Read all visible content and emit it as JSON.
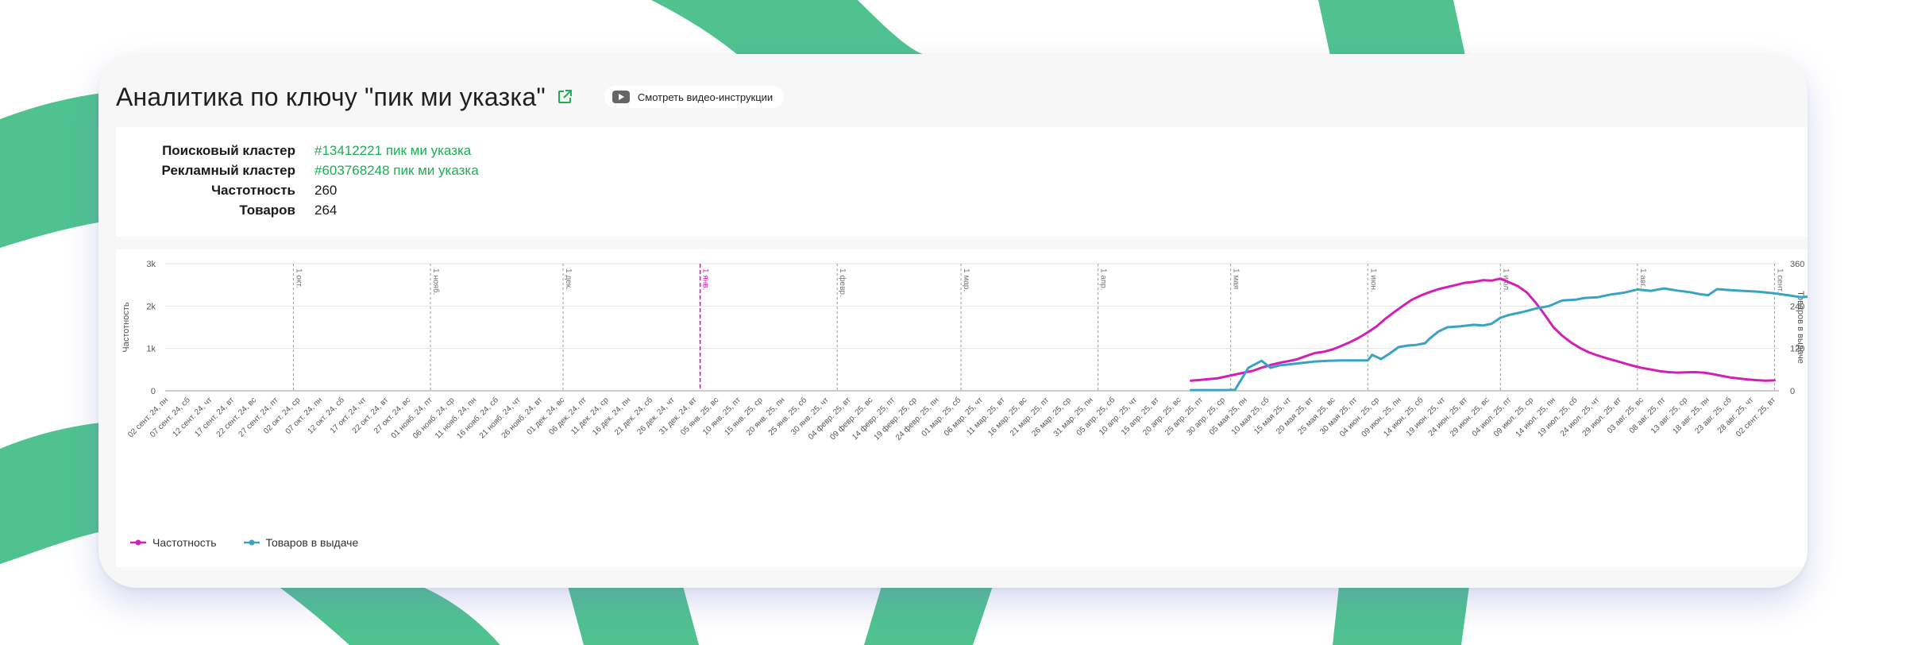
{
  "header": {
    "title": "Аналитика по ключу \"пик ми указка\"",
    "video_button_label": "Смотреть видео-инструкции"
  },
  "info": {
    "search_cluster_label": "Поисковый кластер",
    "search_cluster_value": "#13412221 пик ми указка",
    "ad_cluster_label": "Рекламный кластер",
    "ad_cluster_value": "#603768248 пик ми указка",
    "frequency_label": "Частотность",
    "frequency_value": "260",
    "products_label": "Товаров",
    "products_value": "264"
  },
  "colors": {
    "frequency": "#d21fb6",
    "products": "#3aa3c4",
    "accent_green": "#1fad55",
    "decor_green": "#4fc290"
  },
  "icons": [
    "external-link-icon",
    "video-play-icon"
  ],
  "chart_data": {
    "type": "line",
    "grid": true,
    "legend_position": "bottom-left",
    "y_left": {
      "label": "Частотность",
      "range": [
        0,
        3000
      ],
      "ticks": [
        "0",
        "1k",
        "2k",
        "3k"
      ]
    },
    "y_right": {
      "label": "Товаров в выдаче",
      "range": [
        0,
        360
      ],
      "ticks": [
        "0",
        "120",
        "240",
        "360"
      ]
    },
    "x_start": "2024-09-02",
    "x_end": "2025-09-02",
    "x_tick_labels": [
      "02 сент. 24, пн",
      "07 сент. 24, сб",
      "12 сент. 24, чт",
      "17 сент. 24, вт",
      "22 сент. 24, вс",
      "27 сент. 24, пт",
      "02 окт. 24, ср",
      "07 окт. 24, пн",
      "12 окт. 24, сб",
      "17 окт. 24, чт",
      "22 окт. 24, вт",
      "27 окт. 24, вс",
      "01 нояб. 24, пт",
      "06 нояб. 24, ср",
      "11 нояб. 24, пн",
      "16 нояб. 24, сб",
      "21 нояб. 24, чт",
      "26 нояб. 24, вт",
      "01 дек. 24, вс",
      "06 дек. 24, пт",
      "11 дек. 24, ср",
      "16 дек. 24, пн",
      "21 дек. 24, сб",
      "26 дек. 24, чт",
      "31 дек. 24, вт",
      "05 янв. 25, вс",
      "10 янв. 25, пт",
      "15 янв. 25, ср",
      "20 янв. 25, пн",
      "25 янв. 25, сб",
      "30 янв. 25, чт",
      "04 февр. 25, вт",
      "09 февр. 25, вс",
      "14 февр. 25, пт",
      "19 февр. 25, ср",
      "24 февр. 25, пн",
      "01 мар. 25, сб",
      "06 мар. 25, чт",
      "11 мар. 25, вт",
      "16 мар. 25, вс",
      "21 мар. 25, пт",
      "26 мар. 25, ср",
      "31 мар. 25, пн",
      "05 апр. 25, сб",
      "10 апр. 25, чт",
      "15 апр. 25, вт",
      "20 апр. 25, вс",
      "25 апр. 25, пт",
      "30 апр. 25, ср",
      "05 мая 25, пн",
      "10 мая 25, сб",
      "15 мая 25, чт",
      "20 мая 25, вт",
      "25 мая 25, вс",
      "30 мая 25, пт",
      "04 июн. 25, ср",
      "09 июн. 25, пн",
      "14 июн. 25, сб",
      "19 июн. 25, чт",
      "24 июн. 25, вт",
      "29 июн. 25, вс",
      "04 июл. 25, пт",
      "09 июл. 25, ср",
      "14 июл. 25, пн",
      "19 июл. 25, сб",
      "24 июл. 25, чт",
      "29 июл. 25, вт",
      "03 авг. 25, вс",
      "08 авг. 25, пт",
      "13 авг. 25, ср",
      "18 авг. 25, пн",
      "23 авг. 25, сб",
      "28 авг. 25, чт",
      "02 сент. 25, вт"
    ],
    "month_markers": [
      {
        "date": "2024-10-01",
        "label": "1 окт.",
        "highlight": false
      },
      {
        "date": "2024-11-01",
        "label": "1 нояб.",
        "highlight": false
      },
      {
        "date": "2024-12-01",
        "label": "1 дек.",
        "highlight": false
      },
      {
        "date": "2025-01-01",
        "label": "1 янв.",
        "highlight": true
      },
      {
        "date": "2025-02-01",
        "label": "1 февр.",
        "highlight": false
      },
      {
        "date": "2025-03-01",
        "label": "1 мар.",
        "highlight": false
      },
      {
        "date": "2025-04-01",
        "label": "1 апр.",
        "highlight": false
      },
      {
        "date": "2025-05-01",
        "label": "1 мая",
        "highlight": false
      },
      {
        "date": "2025-06-01",
        "label": "1 июн.",
        "highlight": false
      },
      {
        "date": "2025-07-01",
        "label": "1 июл.",
        "highlight": false
      },
      {
        "date": "2025-08-01",
        "label": "1 авг.",
        "highlight": false
      },
      {
        "date": "2025-09-01",
        "label": "1 сент.",
        "highlight": false
      }
    ],
    "series": [
      {
        "name": "Частотность",
        "axis": "left",
        "points": [
          [
            "2025-04-22",
            240
          ],
          [
            "2025-04-24",
            255
          ],
          [
            "2025-04-26",
            275
          ],
          [
            "2025-04-28",
            295
          ],
          [
            "2025-04-30",
            340
          ],
          [
            "2025-05-02",
            385
          ],
          [
            "2025-05-04",
            430
          ],
          [
            "2025-05-06",
            470
          ],
          [
            "2025-05-08",
            545
          ],
          [
            "2025-05-10",
            610
          ],
          [
            "2025-05-12",
            660
          ],
          [
            "2025-05-14",
            700
          ],
          [
            "2025-05-16",
            745
          ],
          [
            "2025-05-18",
            820
          ],
          [
            "2025-05-20",
            890
          ],
          [
            "2025-05-22",
            920
          ],
          [
            "2025-05-24",
            975
          ],
          [
            "2025-05-26",
            1060
          ],
          [
            "2025-05-28",
            1150
          ],
          [
            "2025-05-30",
            1255
          ],
          [
            "2025-06-01",
            1380
          ],
          [
            "2025-06-03",
            1520
          ],
          [
            "2025-06-05",
            1700
          ],
          [
            "2025-06-07",
            1860
          ],
          [
            "2025-06-09",
            2010
          ],
          [
            "2025-06-11",
            2150
          ],
          [
            "2025-06-13",
            2250
          ],
          [
            "2025-06-15",
            2330
          ],
          [
            "2025-06-17",
            2400
          ],
          [
            "2025-06-19",
            2450
          ],
          [
            "2025-06-21",
            2500
          ],
          [
            "2025-06-23",
            2550
          ],
          [
            "2025-06-25",
            2570
          ],
          [
            "2025-06-27",
            2610
          ],
          [
            "2025-06-29",
            2600
          ],
          [
            "2025-07-01",
            2650
          ],
          [
            "2025-07-03",
            2560
          ],
          [
            "2025-07-05",
            2470
          ],
          [
            "2025-07-07",
            2320
          ],
          [
            "2025-07-09",
            2080
          ],
          [
            "2025-07-11",
            1800
          ],
          [
            "2025-07-13",
            1500
          ],
          [
            "2025-07-15",
            1300
          ],
          [
            "2025-07-17",
            1140
          ],
          [
            "2025-07-19",
            1010
          ],
          [
            "2025-07-21",
            910
          ],
          [
            "2025-07-23",
            835
          ],
          [
            "2025-07-25",
            770
          ],
          [
            "2025-07-27",
            710
          ],
          [
            "2025-07-29",
            650
          ],
          [
            "2025-07-31",
            590
          ],
          [
            "2025-08-02",
            540
          ],
          [
            "2025-08-04",
            505
          ],
          [
            "2025-08-06",
            465
          ],
          [
            "2025-08-08",
            440
          ],
          [
            "2025-08-10",
            430
          ],
          [
            "2025-08-12",
            435
          ],
          [
            "2025-08-14",
            440
          ],
          [
            "2025-08-16",
            430
          ],
          [
            "2025-08-18",
            395
          ],
          [
            "2025-08-20",
            355
          ],
          [
            "2025-08-22",
            315
          ],
          [
            "2025-08-24",
            290
          ],
          [
            "2025-08-26",
            268
          ],
          [
            "2025-08-28",
            252
          ],
          [
            "2025-08-30",
            240
          ],
          [
            "2025-09-01",
            245
          ]
        ]
      },
      {
        "name": "Товаров в выдаче",
        "axis": "right",
        "points": [
          [
            "2025-04-22",
            2
          ],
          [
            "2025-04-26",
            2
          ],
          [
            "2025-04-30",
            2
          ],
          [
            "2025-05-02",
            3
          ],
          [
            "2025-05-05",
            65
          ],
          [
            "2025-05-08",
            85
          ],
          [
            "2025-05-10",
            65
          ],
          [
            "2025-05-12",
            72
          ],
          [
            "2025-05-15",
            76
          ],
          [
            "2025-05-18",
            80
          ],
          [
            "2025-05-20",
            83
          ],
          [
            "2025-05-23",
            85
          ],
          [
            "2025-05-26",
            86
          ],
          [
            "2025-05-29",
            86
          ],
          [
            "2025-06-01",
            86
          ],
          [
            "2025-06-02",
            102
          ],
          [
            "2025-06-04",
            90
          ],
          [
            "2025-06-06",
            106
          ],
          [
            "2025-06-08",
            124
          ],
          [
            "2025-06-10",
            128
          ],
          [
            "2025-06-12",
            130
          ],
          [
            "2025-06-14",
            135
          ],
          [
            "2025-06-15",
            148
          ],
          [
            "2025-06-17",
            168
          ],
          [
            "2025-06-19",
            180
          ],
          [
            "2025-06-22",
            183
          ],
          [
            "2025-06-25",
            187
          ],
          [
            "2025-06-27",
            185
          ],
          [
            "2025-06-29",
            190
          ],
          [
            "2025-07-01",
            207
          ],
          [
            "2025-07-03",
            215
          ],
          [
            "2025-07-06",
            223
          ],
          [
            "2025-07-09",
            233
          ],
          [
            "2025-07-12",
            240
          ],
          [
            "2025-07-15",
            256
          ],
          [
            "2025-07-18",
            258
          ],
          [
            "2025-07-20",
            263
          ],
          [
            "2025-07-23",
            265
          ],
          [
            "2025-07-26",
            273
          ],
          [
            "2025-07-29",
            278
          ],
          [
            "2025-08-01",
            287
          ],
          [
            "2025-08-04",
            283
          ],
          [
            "2025-08-07",
            290
          ],
          [
            "2025-08-10",
            284
          ],
          [
            "2025-08-13",
            279
          ],
          [
            "2025-08-15",
            274
          ],
          [
            "2025-08-17",
            271
          ],
          [
            "2025-08-19",
            288
          ],
          [
            "2025-08-22",
            285
          ],
          [
            "2025-08-25",
            283
          ],
          [
            "2025-08-28",
            281
          ],
          [
            "2025-09-01",
            276
          ],
          [
            "2025-09-04",
            271
          ],
          [
            "2025-09-07",
            265
          ],
          [
            "2025-09-10",
            268
          ],
          [
            "2025-09-13",
            264
          ]
        ]
      }
    ]
  }
}
